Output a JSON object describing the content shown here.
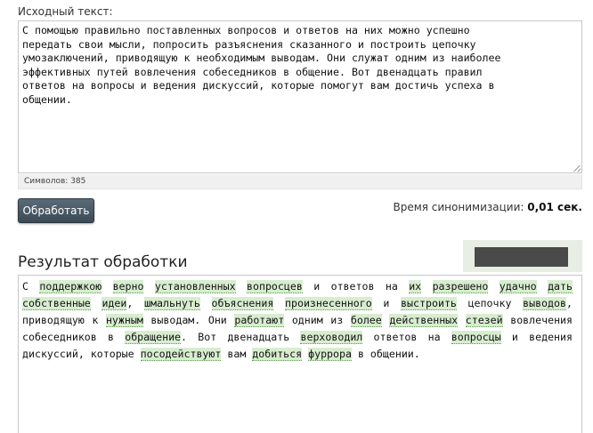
{
  "source": {
    "label": "Исходный текст:",
    "text": "С помощью правильно поставленных вопросов и ответов на них можно успешно\nпередать свои мысли, попросить разъяснения сказанного и построить цепочку\nумозаключений, приводящую к необходимым выводам. Они служат одним из наиболее\nэффективных путей вовлечения собеседников в общение. Вот двенадцать правил\nответов на вопросы и ведения дискуссий, которые помогут вам достичь успеха в\nобщении.",
    "char_count": "Символов: 385"
  },
  "process_button": "Обработать",
  "timing": {
    "label": "Время синонимизации:",
    "value": "0,01 сек."
  },
  "result": {
    "title": "Результат обработки",
    "segments": [
      {
        "t": "С ",
        "s": false
      },
      {
        "t": "поддержкою",
        "s": true
      },
      {
        "t": " ",
        "s": false
      },
      {
        "t": "верно",
        "s": true
      },
      {
        "t": " ",
        "s": false
      },
      {
        "t": "установленных",
        "s": true
      },
      {
        "t": " ",
        "s": false
      },
      {
        "t": "вопросцев",
        "s": true
      },
      {
        "t": " и ответов на ",
        "s": false
      },
      {
        "t": "их",
        "s": true
      },
      {
        "t": " ",
        "s": false
      },
      {
        "t": "разрешено",
        "s": true
      },
      {
        "t": " ",
        "s": false
      },
      {
        "t": "удачно",
        "s": true
      },
      {
        "t": " ",
        "s": false
      },
      {
        "t": "дать",
        "s": true
      },
      {
        "t": " ",
        "s": false
      },
      {
        "t": "собственные",
        "s": true
      },
      {
        "t": " ",
        "s": false
      },
      {
        "t": "идеи",
        "s": true
      },
      {
        "t": ", ",
        "s": false
      },
      {
        "t": "шмальнуть",
        "s": true
      },
      {
        "t": " ",
        "s": false
      },
      {
        "t": "объяснения",
        "s": true
      },
      {
        "t": " ",
        "s": false
      },
      {
        "t": "произнесенного",
        "s": true
      },
      {
        "t": " и ",
        "s": false
      },
      {
        "t": "выстроить",
        "s": true
      },
      {
        "t": " цепочку ",
        "s": false
      },
      {
        "t": "выводов",
        "s": true
      },
      {
        "t": ", приводящую к ",
        "s": false
      },
      {
        "t": "нужным",
        "s": true
      },
      {
        "t": " выводам. Они ",
        "s": false
      },
      {
        "t": "работают",
        "s": true
      },
      {
        "t": " одним из ",
        "s": false
      },
      {
        "t": "более",
        "s": true
      },
      {
        "t": " ",
        "s": false
      },
      {
        "t": "действенных",
        "s": true
      },
      {
        "t": " ",
        "s": false
      },
      {
        "t": "стезей",
        "s": true
      },
      {
        "t": " вовлечения собеседников в ",
        "s": false
      },
      {
        "t": "обращение",
        "s": true
      },
      {
        "t": ". Вот двенадцать ",
        "s": false
      },
      {
        "t": "верховодил",
        "s": true
      },
      {
        "t": " ответов на ",
        "s": false
      },
      {
        "t": "вопросцы",
        "s": true
      },
      {
        "t": " и ведения дискуссий, которые ",
        "s": false
      },
      {
        "t": "посодействуют",
        "s": true
      },
      {
        "t": " вам ",
        "s": false
      },
      {
        "t": "добиться",
        "s": true
      },
      {
        "t": " ",
        "s": false
      },
      {
        "t": "фуррора",
        "s": true
      },
      {
        "t": " в общении.",
        "s": false
      }
    ]
  },
  "colors": {
    "synonym_highlight": "#d8edd0",
    "button": "#3b4a55"
  }
}
